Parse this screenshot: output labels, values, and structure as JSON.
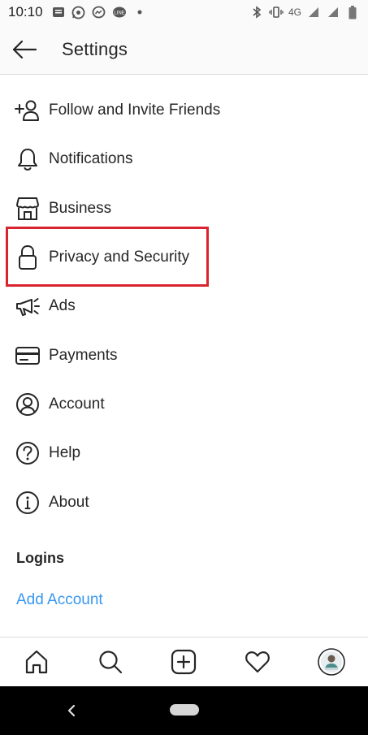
{
  "status_bar": {
    "time": "10:10",
    "network": "4G"
  },
  "header": {
    "title": "Settings"
  },
  "menu": {
    "items": [
      {
        "label": "Follow and Invite Friends",
        "icon": "add-person-icon"
      },
      {
        "label": "Notifications",
        "icon": "bell-icon"
      },
      {
        "label": "Business",
        "icon": "storefront-icon"
      },
      {
        "label": "Privacy and Security",
        "icon": "lock-icon"
      },
      {
        "label": "Ads",
        "icon": "megaphone-icon"
      },
      {
        "label": "Payments",
        "icon": "credit-card-icon"
      },
      {
        "label": "Account",
        "icon": "person-circle-icon"
      },
      {
        "label": "Help",
        "icon": "help-circle-icon"
      },
      {
        "label": "About",
        "icon": "info-circle-icon"
      }
    ]
  },
  "logins": {
    "title": "Logins",
    "add_account": "Add Account"
  },
  "tab_bar": {
    "tabs": [
      "home-icon",
      "search-icon",
      "new-post-icon",
      "heart-icon",
      "profile-avatar"
    ]
  },
  "colors": {
    "highlight": "#d9232e",
    "link": "#3897f0"
  }
}
